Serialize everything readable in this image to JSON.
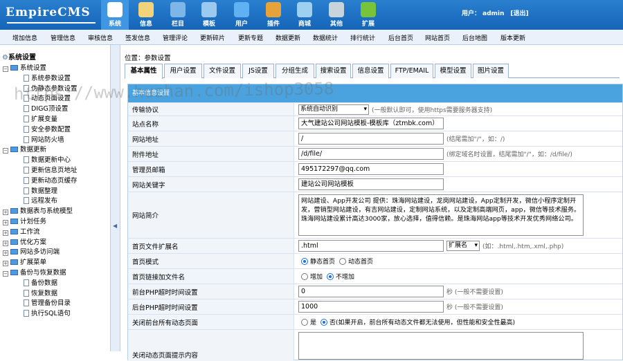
{
  "app": {
    "logo": "EmpireCMS"
  },
  "top_menu": [
    {
      "label": "系统",
      "icon": "system-icon",
      "color": "#ffffff"
    },
    {
      "label": "信息",
      "icon": "notepad-icon",
      "color": "#f2d37a"
    },
    {
      "label": "栏目",
      "icon": "folder-icon",
      "color": "#7fb6e8"
    },
    {
      "label": "模板",
      "icon": "template-icon",
      "color": "#9cc9f0"
    },
    {
      "label": "用户",
      "icon": "user-icon",
      "color": "#5fb1f2"
    },
    {
      "label": "插件",
      "icon": "tools-icon",
      "color": "#e8a23a"
    },
    {
      "label": "商城",
      "icon": "shop-icon",
      "color": "#9ed0ef"
    },
    {
      "label": "其他",
      "icon": "gear-icon",
      "color": "#c9d3dc"
    },
    {
      "label": "扩展",
      "icon": "plus-circle-icon",
      "color": "#77c33a"
    }
  ],
  "user": {
    "prefix": "用户：",
    "name": "admin",
    "logout": "[退出]"
  },
  "sub_menu": [
    "增加信息",
    "管理信息",
    "审核信息",
    "签发信息",
    "管理评论",
    "更新碎片",
    "更新专题",
    "数据更新",
    "数据统计",
    "排行统计",
    "后台首页",
    "网站首页",
    "后台地图",
    "版本更新"
  ],
  "sidebar": {
    "title": "系统设置",
    "items": [
      {
        "label": "系统设置",
        "type": "folder",
        "box": "−"
      },
      {
        "label": "系统参数设置",
        "type": "page"
      },
      {
        "label": "伪静态参数设置",
        "type": "page"
      },
      {
        "label": "动态页面设置",
        "type": "page"
      },
      {
        "label": "DIGG顶设置",
        "type": "page"
      },
      {
        "label": "扩展变量",
        "type": "page"
      },
      {
        "label": "安全参数配置",
        "type": "page"
      },
      {
        "label": "网站防火墙",
        "type": "page"
      },
      {
        "label": "数据更新",
        "type": "folder",
        "box": "−"
      },
      {
        "label": "数据更新中心",
        "type": "page"
      },
      {
        "label": "更新信息页地址",
        "type": "page"
      },
      {
        "label": "更新动态页缓存",
        "type": "page"
      },
      {
        "label": "数据整理",
        "type": "page"
      },
      {
        "label": "远程发布",
        "type": "page"
      },
      {
        "label": "数据表与系统模型",
        "type": "folder",
        "box": "+"
      },
      {
        "label": "计划任务",
        "type": "folder",
        "box": "+"
      },
      {
        "label": "工作流",
        "type": "folder",
        "box": "+"
      },
      {
        "label": "优化方案",
        "type": "folder",
        "box": "+"
      },
      {
        "label": "网站多访问端",
        "type": "folder",
        "box": "+"
      },
      {
        "label": "扩展菜单",
        "type": "folder",
        "box": "+"
      },
      {
        "label": "备份与恢复数据",
        "type": "folder",
        "box": "−"
      },
      {
        "label": "备份数据",
        "type": "page"
      },
      {
        "label": "恢复数据",
        "type": "page"
      },
      {
        "label": "管理备份目录",
        "type": "page"
      },
      {
        "label": "执行SQL语句",
        "type": "page"
      }
    ]
  },
  "breadcrumb": "位置：参数设置",
  "tabs": [
    "基本属性",
    "用户设置",
    "文件设置",
    "JS设置",
    "分组生成",
    "搜索设置",
    "信息设置",
    "FTP/EMAIL",
    "模型设置",
    "图片设置"
  ],
  "panel": {
    "title": "基本信息设置"
  },
  "form": {
    "protocol": {
      "label": "传输协议",
      "value": "系统自动识别",
      "hint": "(一般默认即可，使用https需要服务器支持)"
    },
    "site_name": {
      "label": "站点名称",
      "value": "大气建站公司网站模板-模板库（ztmbk.com）"
    },
    "site_url": {
      "label": "网站地址",
      "value": "/",
      "hint": "(结尾需加\"/\"，如：/)"
    },
    "attach_url": {
      "label": "附件地址",
      "value": "/d/file/",
      "hint": "(绑定域名时设置，结尾需加\"/\"，如：/d/file/)"
    },
    "admin_email": {
      "label": "管理员邮箱",
      "value": "495172297@qq.com"
    },
    "keywords": {
      "label": "网站关键字",
      "value": "建站公司网站模板"
    },
    "intro": {
      "label": "网站简介",
      "value": "网站建设、App开发公司 提供：珠海网站建设，龙岗网站建设，App定制开发，微信小程序定制开发，营销型网站建设，有吉网站建设，定制网站系统，以及定制高端网页，app，微信等技术服务。珠海网站建设累计高达3000家，放心选择，值得信赖。是珠海网站app等技术开发优秀网络公司。"
    },
    "ext": {
      "label": "首页文件扩展名",
      "value": ".html",
      "select": "扩展名",
      "hint": "(如：.html,.htm,.xml,.php)"
    },
    "index_mode": {
      "label": "首页模式",
      "opt1": "静态首页",
      "opt2": "动态首页"
    },
    "index_link": {
      "label": "首页链接加文件名",
      "opt1": "增加",
      "opt2": "不增加"
    },
    "front_timeout": {
      "label": "前台PHP超时时间设置",
      "value": "0",
      "hint": "秒 (一般不需要设置)"
    },
    "back_timeout": {
      "label": "后台PHP超时时间设置",
      "value": "1000",
      "hint": "秒 (一般不需要设置)"
    },
    "close_dynamic": {
      "label": "关闭前台所有动态页面",
      "opt1": "是",
      "opt2": "否",
      "hint": "(如果开启，前台所有动态文件都无法使用，但性能和安全性最高)"
    },
    "close_tip": {
      "label": "关闭动态页面提示内容"
    }
  },
  "watermark": "https://www.huzhan.com/ishop3058"
}
